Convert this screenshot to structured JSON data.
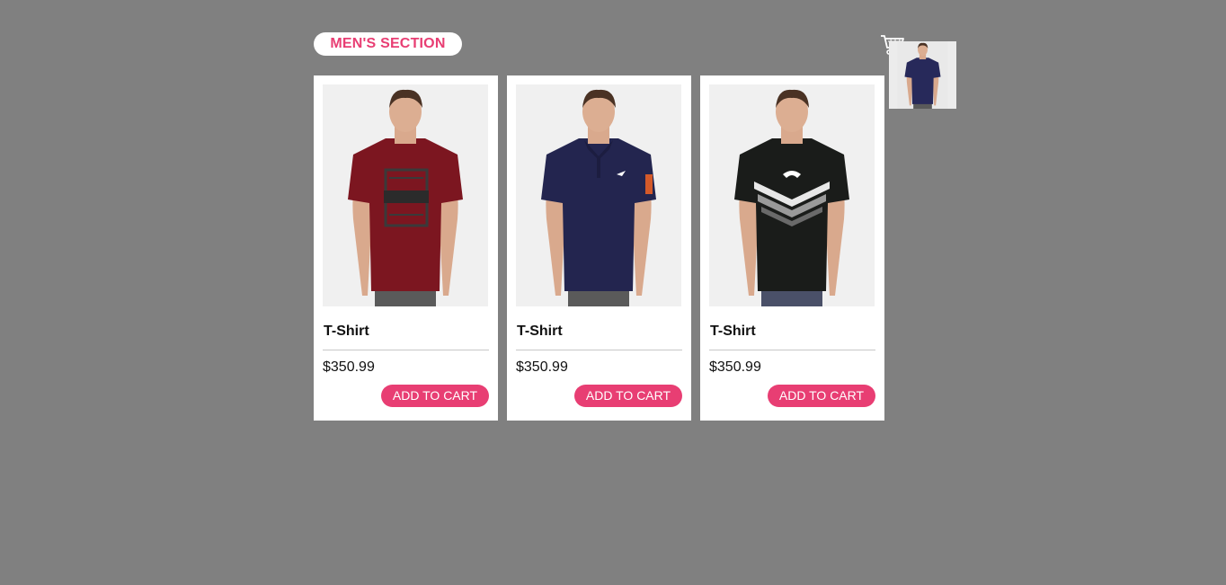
{
  "header": {
    "section_label": "MEN'S SECTION"
  },
  "cart": {
    "icon": "shopping-cart-icon",
    "thumbnail_shirt_color": "#27295a"
  },
  "products": [
    {
      "title": "T-Shirt",
      "price": "$350.99",
      "button_label": "ADD TO CART",
      "shirt_color": "#7c1620",
      "graphic": "print"
    },
    {
      "title": "T-Shirt",
      "price": "$350.99",
      "button_label": "ADD TO CART",
      "shirt_color": "#23254f",
      "graphic": "polo"
    },
    {
      "title": "T-Shirt",
      "price": "$350.99",
      "button_label": "ADD TO CART",
      "shirt_color": "#1a1c1a",
      "graphic": "chevron"
    }
  ],
  "colors": {
    "accent": "#e83e73",
    "background": "#808080",
    "card": "#ffffff"
  }
}
